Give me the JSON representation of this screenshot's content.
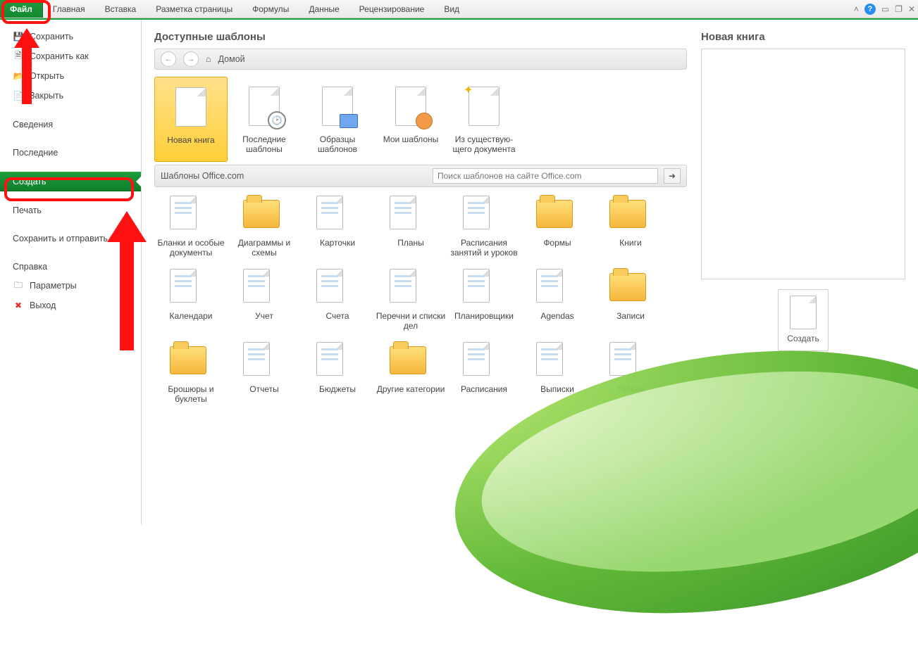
{
  "ribbon": {
    "file": "Файл",
    "tabs": [
      "Главная",
      "Вставка",
      "Разметка страницы",
      "Формулы",
      "Данные",
      "Рецензирование",
      "Вид"
    ]
  },
  "sidebar": {
    "items": [
      {
        "label": "Сохранить"
      },
      {
        "label": "Сохранить как"
      },
      {
        "label": "Открыть"
      },
      {
        "label": "Закрыть"
      },
      {
        "label": "Сведения"
      },
      {
        "label": "Последние"
      },
      {
        "label": "Создать"
      },
      {
        "label": "Печать"
      },
      {
        "label": "Сохранить и отправить"
      },
      {
        "label": "Справка"
      },
      {
        "label": "Параметры"
      },
      {
        "label": "Выход"
      }
    ]
  },
  "center": {
    "title": "Доступные шаблоны",
    "home": "Домой",
    "top_tiles": [
      {
        "label": "Новая книга"
      },
      {
        "label": "Последние шаблоны"
      },
      {
        "label": "Образцы шаблонов"
      },
      {
        "label": "Мои шаблоны"
      },
      {
        "label": "Из существую­щего документа"
      }
    ],
    "office_section": "Шаблоны Office.com",
    "search_placeholder": "Поиск шаблонов на сайте Office.com",
    "grid": [
      "Бланки и особые документы",
      "Диаграммы и схемы",
      "Карточки",
      "Планы",
      "Расписания занятий и уроков",
      "Формы",
      "Книги",
      "Календари",
      "Учет",
      "Счета",
      "Перечни и списки дел",
      "Планировщики",
      "Agendas",
      "Записи",
      "Брошюры и буклеты",
      "Отчеты",
      "Бюджеты",
      "Другие категории",
      "Расписания",
      "Выписки",
      "Табели"
    ]
  },
  "right": {
    "title": "Новая книга",
    "create": "Создать"
  }
}
